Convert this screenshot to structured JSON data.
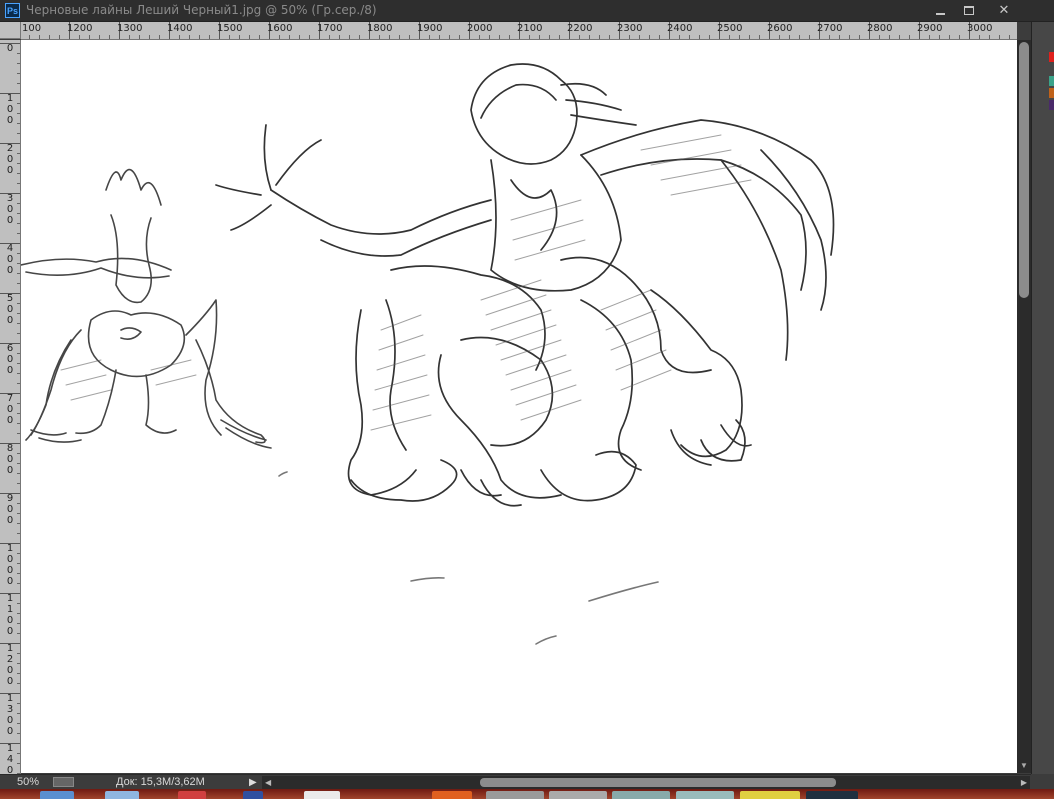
{
  "window": {
    "title": "Черновые лайны Леший Черный1.jpg @ 50% (Гр.сер./8)",
    "app_icon": "Ps"
  },
  "title_buttons": {
    "minimize": "minimize-icon",
    "maximize": "maximize-icon",
    "close": "✕"
  },
  "ruler_h": {
    "labels": [
      "100",
      "1200",
      "1300",
      "1400",
      "1500",
      "1600",
      "1700",
      "1800",
      "1900",
      "2000",
      "2100",
      "2200",
      "2300",
      "2400",
      "2500",
      "2600",
      "2700",
      "2800",
      "2900",
      "3000"
    ]
  },
  "ruler_v": {
    "labels": [
      "0",
      "100",
      "200",
      "300",
      "400",
      "500",
      "600",
      "700",
      "800",
      "900",
      "1000",
      "1100",
      "1200",
      "1300",
      "1400"
    ]
  },
  "status": {
    "zoom": "50%",
    "doc_size": "Док: 15,3M/3,62M",
    "arrow": "▶"
  },
  "colors": {
    "swatches": [
      "#e0201c",
      "#3aa38a",
      "#c0621a",
      "#4a2a6a"
    ]
  }
}
